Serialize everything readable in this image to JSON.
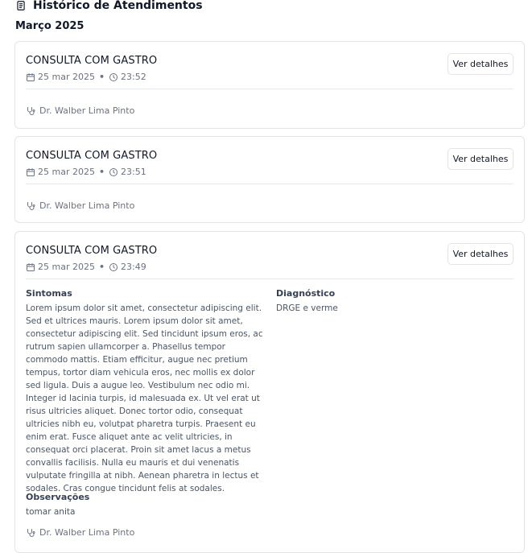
{
  "page": {
    "title": "Histórico de Atendimentos",
    "month": "Março 2025"
  },
  "cards": [
    {
      "title": "CONSULTA COM GASTRO",
      "date": "25 mar 2025",
      "time": "23:52",
      "button": "Ver detalhes",
      "doctor": "Dr. Walber Lima Pinto"
    },
    {
      "title": "CONSULTA COM GASTRO",
      "date": "25 mar 2025",
      "time": "23:51",
      "button": "Ver detalhes",
      "doctor": "Dr. Walber Lima Pinto"
    },
    {
      "title": "CONSULTA COM GASTRO",
      "date": "25 mar 2025",
      "time": "23:49",
      "button": "Ver detalhes",
      "doctor": "Dr. Walber Lima Pinto",
      "symptoms_label": "Sintomas",
      "symptoms": "Lorem ipsum dolor sit amet, consectetur adipiscing elit. Sed et ultrices mauris. Lorem ipsum dolor sit amet, consectetur adipiscing elit. Sed tincidunt ipsum eros, ac rutrum sapien ullamcorper a. Phasellus tempor commodo mattis. Etiam efficitur, augue nec pretium tempus, tortor diam vehicula eros, nec mollis ex dolor sed ligula. Duis a augue leo. Vestibulum nec odio mi. Integer id lacinia turpis, id malesuada ex. Ut vel erat ut risus ultricies aliquet. Donec tortor odio, consequat ultricies nibh eu, volutpat pharetra turpis. Praesent eu enim erat. Fusce aliquet ante ac velit ultricies, in consequat orci placerat. Proin sit amet lacus a metus convallis facilisis. Nulla eu mauris et dui venenatis vulputate fringilla at nibh. Aenean pharetra in lectus et sodales. Cras congue tincidunt felis at sodales.",
      "diagnosis_label": "Diagnóstico",
      "diagnosis": "DRGE e verme",
      "notes_label": "Observações",
      "notes": "tomar anita"
    }
  ],
  "colors": {
    "border": "#e4e4e7",
    "muted_text": "#6b7280",
    "title_text": "#111827"
  },
  "icons": {
    "header": "clipboard-list-icon",
    "date": "calendar-icon",
    "time": "clock-icon",
    "doctor": "stethoscope-icon"
  }
}
